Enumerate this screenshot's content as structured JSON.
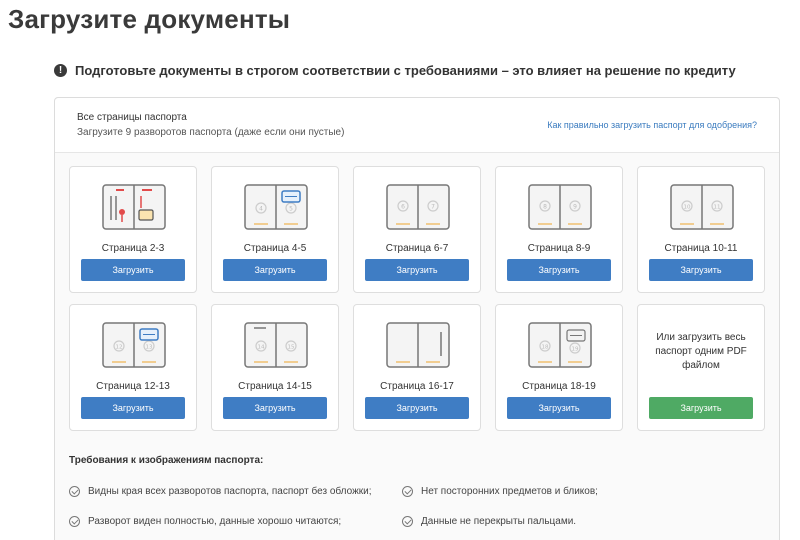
{
  "title": "Загрузите документы",
  "notice": {
    "icon": "exclamation-icon",
    "text": "Подготовьте документы в строгом соответствии с требованиями – это влияет на решение по кредиту"
  },
  "section": {
    "title": "Все страницы паспорта",
    "subtitle": "Загрузите 9 разворотов паспорта (даже если они пустые)",
    "help_link": "Как правильно загрузить паспорт для одобрения?"
  },
  "upload_label": "Загрузить",
  "pages": [
    {
      "label": "Страница 2-3",
      "left": "",
      "right": ""
    },
    {
      "label": "Страница 4-5",
      "left": "4",
      "right": "5"
    },
    {
      "label": "Страница 6-7",
      "left": "6",
      "right": "7"
    },
    {
      "label": "Страница 8-9",
      "left": "8",
      "right": "9"
    },
    {
      "label": "Страница 10-11",
      "left": "10",
      "right": "11"
    },
    {
      "label": "Страница 12-13",
      "left": "12",
      "right": "13"
    },
    {
      "label": "Страница 14-15",
      "left": "14",
      "right": "15"
    },
    {
      "label": "Страница 16-17",
      "left": "",
      "right": ""
    },
    {
      "label": "Страница 18-19",
      "left": "18",
      "right": "19"
    }
  ],
  "pdf_option": {
    "text": "Или загрузить весь паспорт одним PDF файлом",
    "button": "Загрузить"
  },
  "requirements": {
    "title": "Требования к изображениям паспорта:",
    "items": [
      "Видны края всех разворотов паспорта, паспорт без обложки;",
      "Нет посторонних предметов и бликов;",
      "Разворот виден полностью, данные хорошо читаются;",
      "Данные не перекрыты пальцами."
    ]
  },
  "colors": {
    "primary_button": "#3f7dc4",
    "pdf_button": "#4faa64",
    "link": "#3a7bbf",
    "accent_red": "#e24b4b",
    "accent_orange": "#f0c070",
    "accent_blue": "#3f7dc4"
  }
}
